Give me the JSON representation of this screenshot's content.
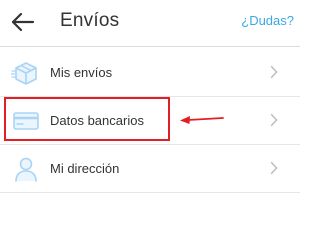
{
  "header": {
    "title": "Envíos",
    "help_label": "¿Dudas?",
    "back_icon": "arrow-left-icon"
  },
  "menu": {
    "items": [
      {
        "label": "Mis envíos",
        "icon": "package-box-icon"
      },
      {
        "label": "Datos bancarios",
        "icon": "credit-card-icon",
        "highlighted": true
      },
      {
        "label": "Mi dirección",
        "icon": "user-icon"
      }
    ]
  },
  "colors": {
    "accent": "#3aa7e8",
    "icon": "#a9d4f5",
    "highlight": "#e31e24",
    "text": "#333333",
    "chevron": "#bdbdbd"
  }
}
